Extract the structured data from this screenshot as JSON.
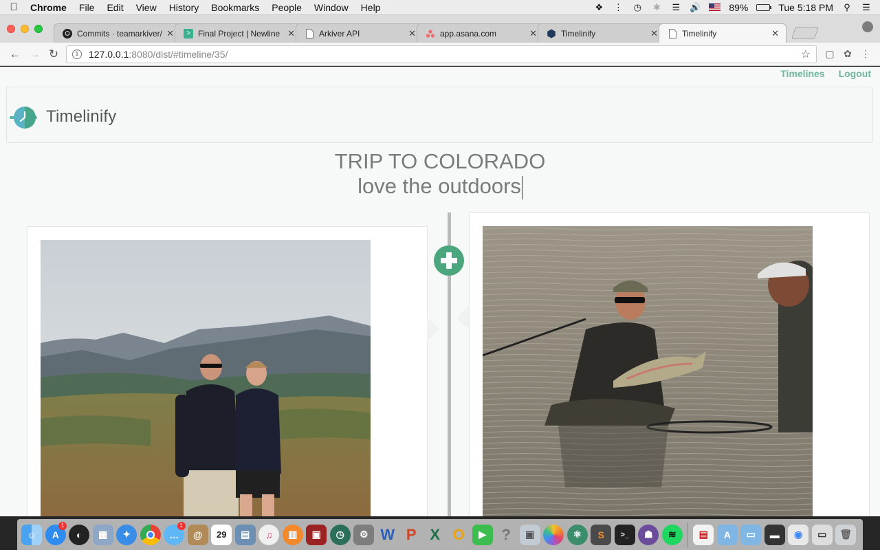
{
  "menubar": {
    "app_name": "Chrome",
    "items": [
      "File",
      "Edit",
      "View",
      "History",
      "Bookmarks",
      "People",
      "Window",
      "Help"
    ],
    "battery": "89%",
    "clock": "Tue 5:18 PM"
  },
  "tabs": [
    {
      "title": "Commits · teamarkiver/",
      "icon": "github-icon",
      "active": false
    },
    {
      "title": "Final Project | Newline",
      "icon": "newline-icon",
      "active": false
    },
    {
      "title": "Arkiver API",
      "icon": "document-icon",
      "active": false
    },
    {
      "title": "app.asana.com",
      "icon": "asana-icon",
      "active": false
    },
    {
      "title": "Timelinify",
      "icon": "hexagon-icon",
      "active": false
    },
    {
      "title": "Timelinify",
      "icon": "document-icon",
      "active": true
    }
  ],
  "toolbar": {
    "url_host": "127.0.0.1",
    "url_rest": ":8080/dist/#timeline/35/"
  },
  "page": {
    "links": {
      "timelines": "Timelines",
      "logout": "Logout"
    },
    "brand": "Timelinify",
    "title": "TRIP TO COLORADO",
    "subtitle": "love the outdoors",
    "accent_color": "#4ca67d",
    "link_color": "#6fb89b"
  },
  "dock": {
    "calendar_day": "29",
    "badges": {
      "app_store": "1",
      "messages": "1"
    }
  }
}
